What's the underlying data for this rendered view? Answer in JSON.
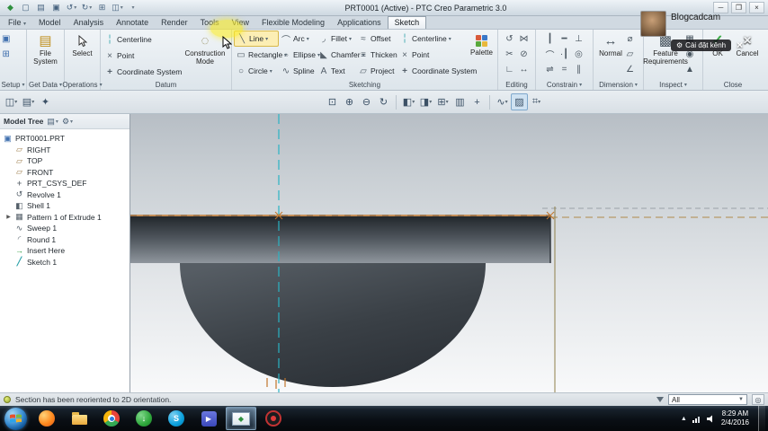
{
  "colors": {
    "ok_green": "#3fae49",
    "cancel_x": "#eef1f3",
    "centerline_cyan": "#2ab3c4",
    "selected_sketch_orange": "#c0762c",
    "highlight_yellow": "#fae928"
  },
  "titlebar": {
    "title": "PRT0001 (Active) - PTC Creo Parametric 3.0"
  },
  "tabs": [
    "File",
    "Model",
    "Analysis",
    "Annotate",
    "Render",
    "Tools",
    "View",
    "Flexible Modeling",
    "Applications",
    "Sketch"
  ],
  "ribbon": {
    "setup_label": "Setup",
    "get_data_label": "Get Data",
    "operations_label": "Operations",
    "datum_label": "Datum",
    "sketching_label": "Sketching",
    "editing_label": "Editing",
    "constrain_label": "Constrain",
    "dimension_label": "Dimension",
    "inspect_label": "Inspect",
    "close_label": "Close",
    "file_system": "File System",
    "select": "Select",
    "datum": {
      "centerline": "Centerline",
      "point": "Point",
      "coordinate_system": "Coordinate System",
      "construction_mode": "Construction Mode"
    },
    "sketching": {
      "line": "Line",
      "rectangle": "Rectangle",
      "circle": "Circle",
      "arc": "Arc",
      "ellipse": "Ellipse",
      "spline": "Spline",
      "fillet": "Fillet",
      "chamfer": "Chamfer",
      "text": "Text",
      "offset": "Offset",
      "thicken": "Thicken",
      "project": "Project",
      "centerline": "Centerline",
      "point": "Point",
      "coordinate_system": "Coordinate System",
      "palette": "Palette"
    },
    "dimension": {
      "normal": "Normal"
    },
    "inspect": {
      "feature_requirements": "Feature Requirements"
    },
    "close": {
      "ok": "OK",
      "cancel": "Cancel"
    }
  },
  "model_tree": {
    "title": "Model Tree",
    "items": [
      {
        "label": "PRT0001.PRT",
        "icon": "part"
      },
      {
        "label": "RIGHT",
        "icon": "datum-plane"
      },
      {
        "label": "TOP",
        "icon": "datum-plane"
      },
      {
        "label": "FRONT",
        "icon": "datum-plane"
      },
      {
        "label": "PRT_CSYS_DEF",
        "icon": "coordinate-system"
      },
      {
        "label": "Revolve 1",
        "icon": "revolve"
      },
      {
        "label": "Shell 1",
        "icon": "shell"
      },
      {
        "label": "Pattern 1 of Extrude 1",
        "icon": "pattern"
      },
      {
        "label": "Sweep 1",
        "icon": "sweep"
      },
      {
        "label": "Round 1",
        "icon": "round"
      },
      {
        "label": "Insert Here",
        "icon": "insert-here"
      },
      {
        "label": "Sketch 1",
        "icon": "sketch"
      }
    ]
  },
  "statusbar": {
    "message": "Section has been reoriented to 2D orientation.",
    "filter_value": "All"
  },
  "channel_overlay": {
    "name": "Blogcadcam",
    "settings_button": "Cài đặt kênh"
  },
  "taskbar": {
    "clock_time": "8:29 AM",
    "clock_date": "2/4/2016"
  }
}
